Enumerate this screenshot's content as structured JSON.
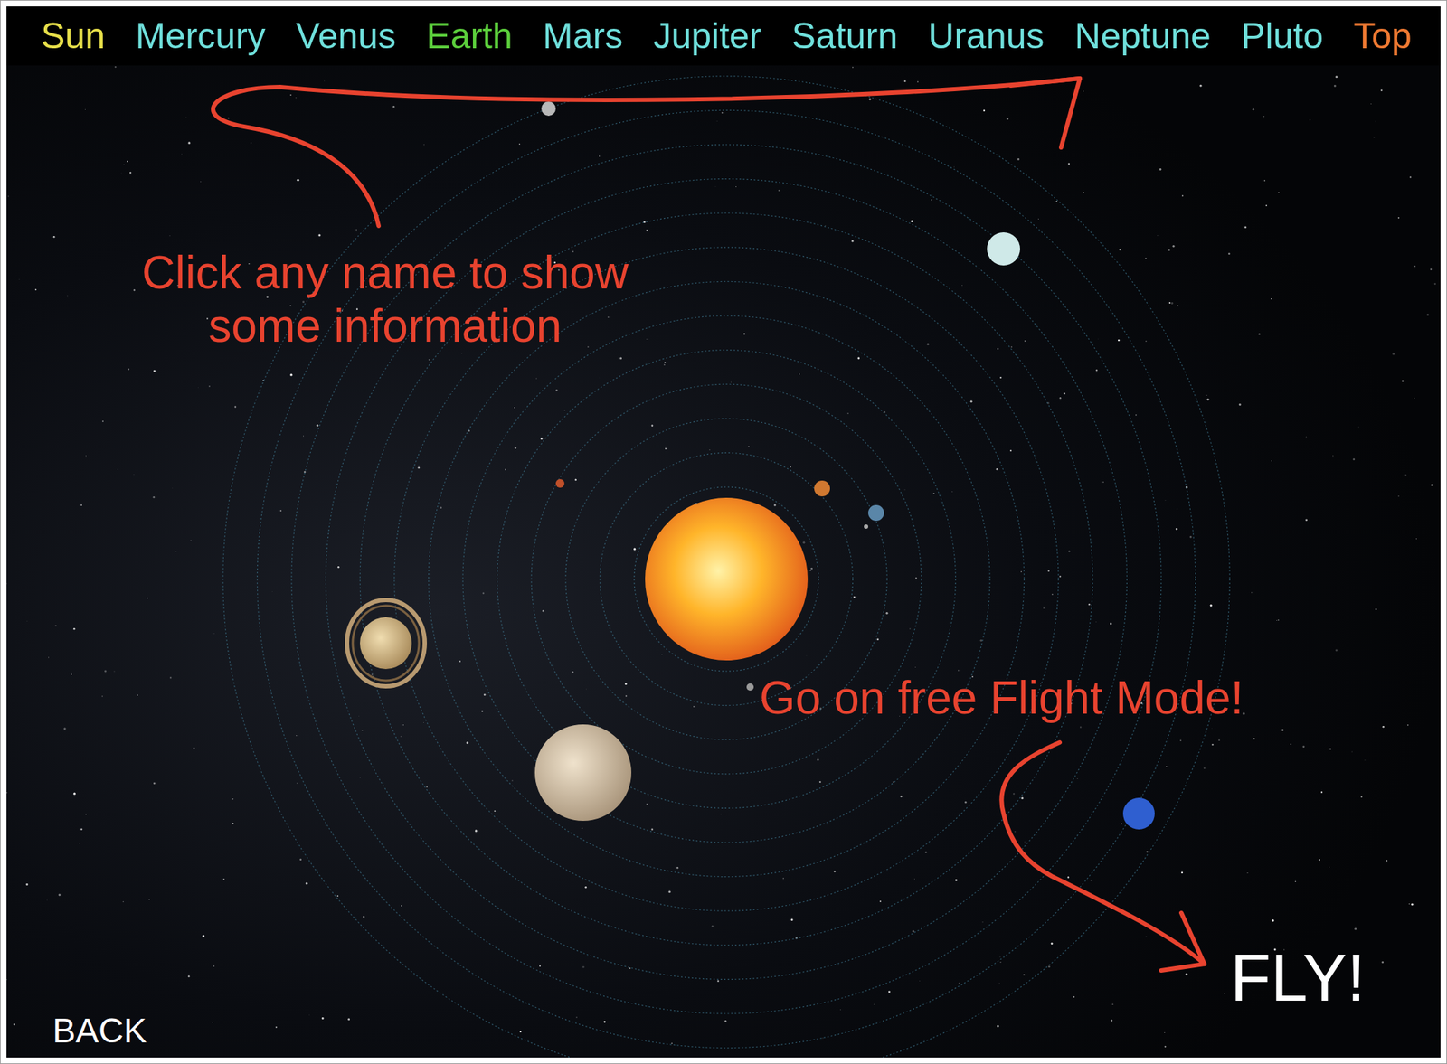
{
  "top_bar": {
    "items": [
      {
        "label": "Sun",
        "color": "#e8e04a"
      },
      {
        "label": "Mercury",
        "color": "#6fe0dc"
      },
      {
        "label": "Venus",
        "color": "#6fe0dc"
      },
      {
        "label": "Earth",
        "color": "#5ccf3c"
      },
      {
        "label": "Mars",
        "color": "#6fe0dc"
      },
      {
        "label": "Jupiter",
        "color": "#6fe0dc"
      },
      {
        "label": "Saturn",
        "color": "#6fe0dc"
      },
      {
        "label": "Uranus",
        "color": "#6fe0dc"
      },
      {
        "label": "Neptune",
        "color": "#6fe0dc"
      },
      {
        "label": "Pluto",
        "color": "#6fe0dc"
      },
      {
        "label": "Top",
        "color": "#f07a32"
      }
    ]
  },
  "annotations": {
    "info": [
      "Click any name to show",
      "some information"
    ],
    "flight": "Go on free Flight Mode!"
  },
  "buttons": {
    "fly": "FLY!",
    "back": "BACK"
  }
}
